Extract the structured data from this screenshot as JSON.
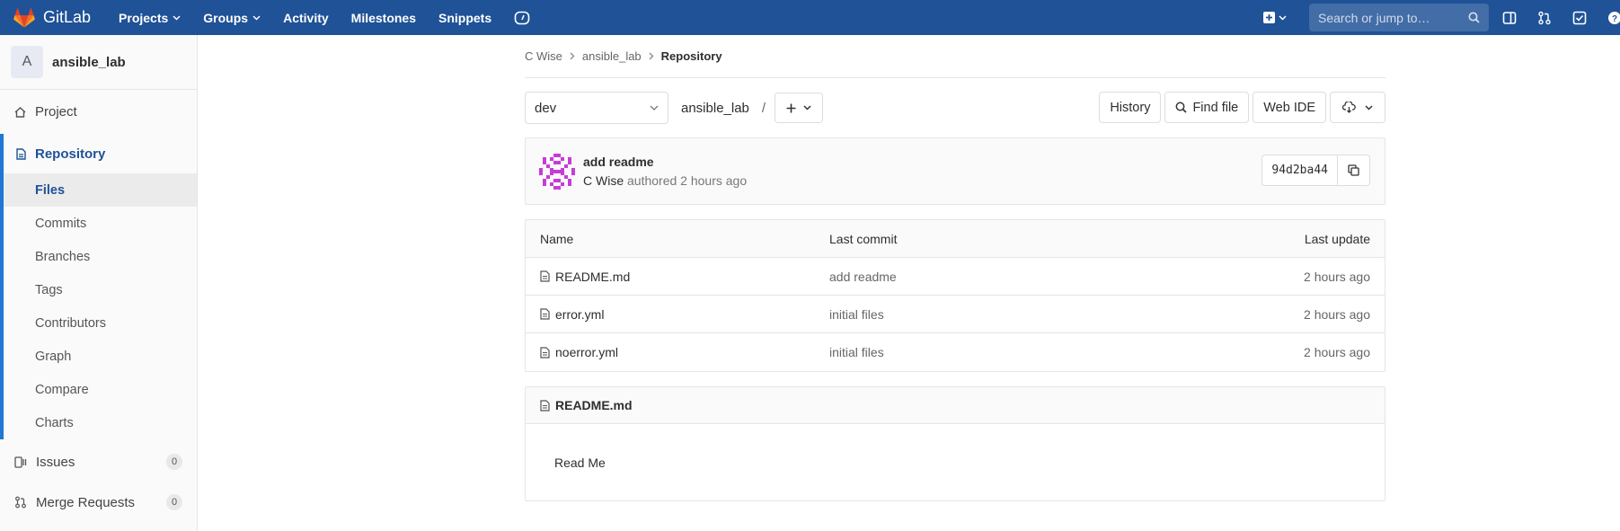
{
  "topbar": {
    "brand": "GitLab",
    "nav": [
      "Projects",
      "Groups",
      "Activity",
      "Milestones",
      "Snippets"
    ],
    "search_placeholder": "Search or jump to…"
  },
  "sidebar": {
    "project_initial": "A",
    "project_name": "ansible_lab",
    "project_label": "Project",
    "repository_label": "Repository",
    "repo_items": [
      "Files",
      "Commits",
      "Branches",
      "Tags",
      "Contributors",
      "Graph",
      "Compare",
      "Charts"
    ],
    "issues_label": "Issues",
    "issues_count": "0",
    "mr_label": "Merge Requests",
    "mr_count": "0"
  },
  "breadcrumb": [
    "C Wise",
    "ansible_lab",
    "Repository"
  ],
  "toolbar": {
    "branch": "dev",
    "path": "ansible_lab",
    "separator": "/",
    "history": "History",
    "find_file": "Find file",
    "web_ide": "Web IDE"
  },
  "commit": {
    "title": "add readme",
    "author": "C Wise",
    "meta": "authored 2 hours ago",
    "sha": "94d2ba44"
  },
  "tree": {
    "headers": [
      "Name",
      "Last commit",
      "Last update"
    ],
    "rows": [
      {
        "name": "README.md",
        "commit": "add readme",
        "updated": "2 hours ago"
      },
      {
        "name": "error.yml",
        "commit": "initial files",
        "updated": "2 hours ago"
      },
      {
        "name": "noerror.yml",
        "commit": "initial files",
        "updated": "2 hours ago"
      }
    ]
  },
  "readme": {
    "filename": "README.md",
    "content": "Read Me"
  },
  "colors": {
    "nav_bg": "#1f5297",
    "accent": "#1f78d1"
  }
}
